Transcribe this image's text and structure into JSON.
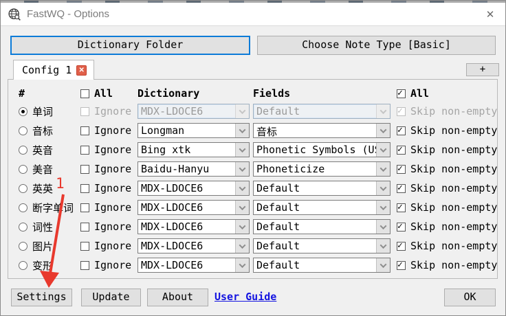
{
  "window": {
    "title": "FastWQ - Options",
    "close_glyph": "✕"
  },
  "top_buttons": {
    "dictionary_folder": "Dictionary Folder",
    "choose_note_type": "Choose Note Type [Basic]"
  },
  "tabs": {
    "active_label": "Config 1",
    "close_glyph": "✕",
    "add_label": "+"
  },
  "table": {
    "headers": {
      "hash": "#",
      "all_left": "All",
      "dictionary": "Dictionary",
      "fields": "Fields",
      "all_right": "All"
    },
    "rows": [
      {
        "label": "单词",
        "selected": true,
        "disabled": true,
        "ignore_label": "Ignore",
        "ignore_checked": false,
        "dictionary": "MDX-LDOCE6",
        "fields": "Default",
        "skip_label": "Skip non-empty",
        "skip_checked": true
      },
      {
        "label": "音标",
        "selected": false,
        "disabled": false,
        "ignore_label": "Ignore",
        "ignore_checked": false,
        "dictionary": "Longman",
        "fields": "音标",
        "skip_label": "Skip non-empty",
        "skip_checked": true
      },
      {
        "label": "英音",
        "selected": false,
        "disabled": false,
        "ignore_label": "Ignore",
        "ignore_checked": false,
        "dictionary": "Bing xtk",
        "fields": "Phonetic Symbols (US)",
        "skip_label": "Skip non-empty",
        "skip_checked": true
      },
      {
        "label": "美音",
        "selected": false,
        "disabled": false,
        "ignore_label": "Ignore",
        "ignore_checked": false,
        "dictionary": "Baidu-Hanyu",
        "fields": "Phoneticize",
        "skip_label": "Skip non-empty",
        "skip_checked": true
      },
      {
        "label": "英英",
        "selected": false,
        "disabled": false,
        "ignore_label": "Ignore",
        "ignore_checked": false,
        "dictionary": "MDX-LDOCE6",
        "fields": "Default",
        "skip_label": "Skip non-empty",
        "skip_checked": true
      },
      {
        "label": "断字单词",
        "selected": false,
        "disabled": false,
        "ignore_label": "Ignore",
        "ignore_checked": false,
        "dictionary": "MDX-LDOCE6",
        "fields": "Default",
        "skip_label": "Skip non-empty",
        "skip_checked": true
      },
      {
        "label": "词性",
        "selected": false,
        "disabled": false,
        "ignore_label": "Ignore",
        "ignore_checked": false,
        "dictionary": "MDX-LDOCE6",
        "fields": "Default",
        "skip_label": "Skip non-empty",
        "skip_checked": true
      },
      {
        "label": "图片",
        "selected": false,
        "disabled": false,
        "ignore_label": "Ignore",
        "ignore_checked": false,
        "dictionary": "MDX-LDOCE6",
        "fields": "Default",
        "skip_label": "Skip non-empty",
        "skip_checked": true
      },
      {
        "label": "变形",
        "selected": false,
        "disabled": false,
        "ignore_label": "Ignore",
        "ignore_checked": false,
        "dictionary": "MDX-LDOCE6",
        "fields": "Default",
        "skip_label": "Skip non-empty",
        "skip_checked": true
      }
    ]
  },
  "footer": {
    "settings": "Settings",
    "update": "Update",
    "about": "About",
    "user_guide": "User Guide",
    "ok": "OK"
  },
  "annotation": {
    "step_number": "1",
    "color": "#e8392d"
  }
}
